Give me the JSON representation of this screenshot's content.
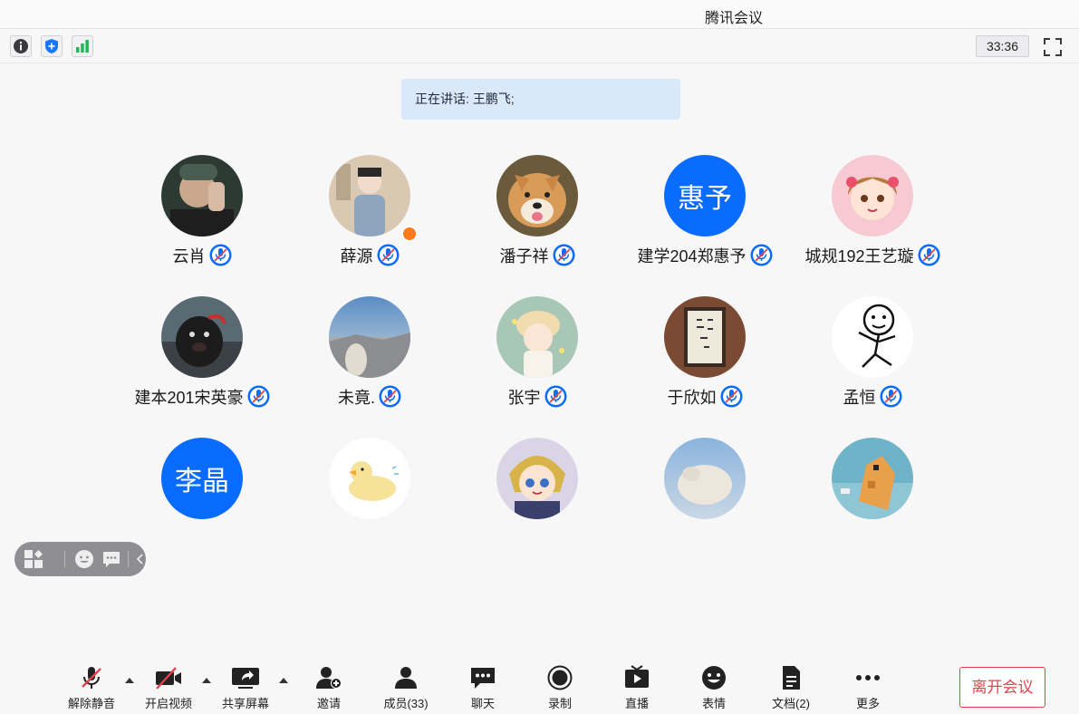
{
  "window": {
    "title": "腾讯会议"
  },
  "infobar": {
    "icons": [
      "info-icon",
      "shield-icon",
      "signal-icon"
    ],
    "timer": "33:36",
    "fullscreen_icon": "fullscreen-icon"
  },
  "speaking": {
    "prefix": "正在讲话:",
    "name": "王鹏飞;"
  },
  "participants": [
    {
      "name": "云肖",
      "avatar": "photo",
      "muted": true
    },
    {
      "name": "薛源",
      "avatar": "photo",
      "muted": true,
      "badge": "host-icon"
    },
    {
      "name": "潘子祥",
      "avatar": "photo",
      "muted": true
    },
    {
      "name": "建学204郑惠予",
      "avatar": "text",
      "avatar_text": "惠予",
      "muted": true
    },
    {
      "name": "城规192王艺璇",
      "avatar": "photo",
      "muted": true
    },
    {
      "name": "建本201宋英豪",
      "avatar": "photo",
      "muted": true
    },
    {
      "name": "未竟.",
      "avatar": "photo",
      "muted": true
    },
    {
      "name": "张宇",
      "avatar": "photo",
      "muted": true
    },
    {
      "name": "于欣如",
      "avatar": "photo",
      "muted": true
    },
    {
      "name": "孟恒",
      "avatar": "photo",
      "muted": true
    },
    {
      "name": "",
      "avatar": "text",
      "avatar_text": "李晶"
    },
    {
      "name": "",
      "avatar": "photo"
    },
    {
      "name": "",
      "avatar": "photo"
    },
    {
      "name": "",
      "avatar": "photo"
    },
    {
      "name": "",
      "avatar": "photo"
    }
  ],
  "floating_bar": {
    "icons": [
      "layout-icon",
      "emoji-icon",
      "chat-icon",
      "collapse-icon"
    ]
  },
  "toolbar": {
    "unmute": "解除静音",
    "start_video": "开启视频",
    "share_screen": "共享屏幕",
    "invite": "邀请",
    "members": "成员(33)",
    "chat": "聊天",
    "record": "录制",
    "live": "直播",
    "reactions": "表情",
    "docs": "文档(2)",
    "more": "更多",
    "leave": "离开会议"
  },
  "colors": {
    "accent": "#0a6cff",
    "leave": "#e3414a",
    "speaking_bg": "#d9e8fb"
  }
}
